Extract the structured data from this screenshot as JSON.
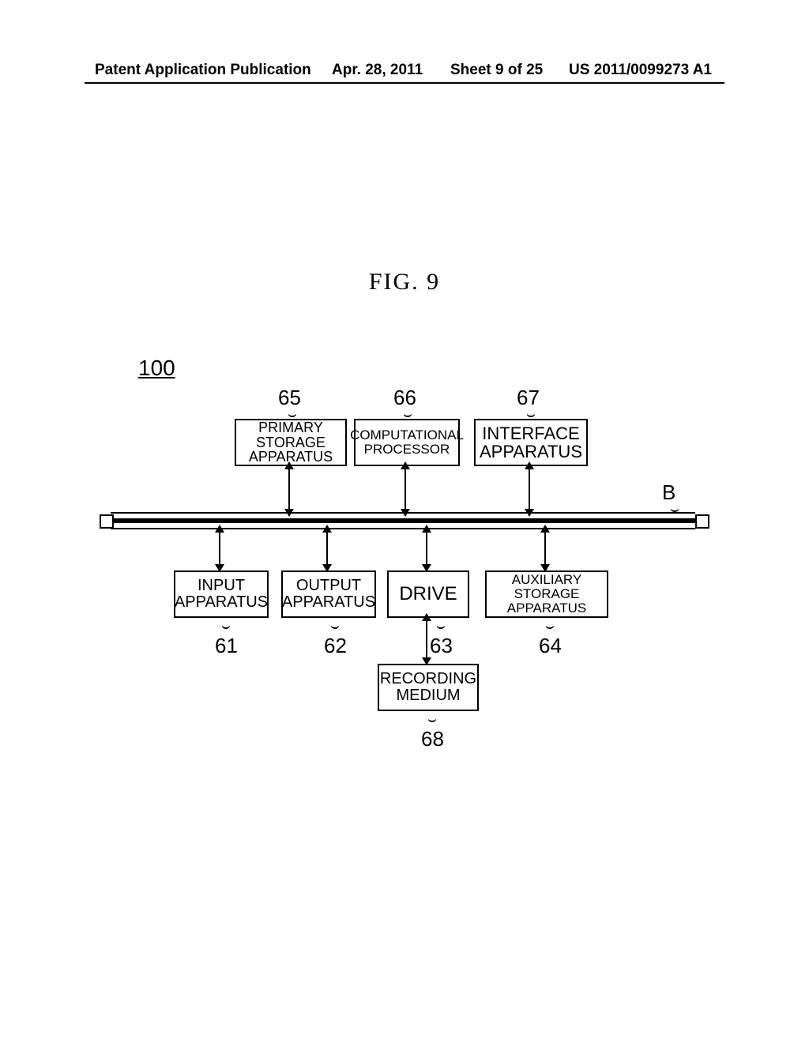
{
  "header": {
    "pub": "Patent Application Publication",
    "date": "Apr. 28, 2011",
    "sheet": "Sheet 9 of 25",
    "code": "US 2011/0099273 A1"
  },
  "figure_title": "FIG. 9",
  "ref100": "100",
  "bus_label": "B",
  "boxes": {
    "b65": {
      "l1": "PRIMARY STORAGE",
      "l2": "APPARATUS"
    },
    "b66": {
      "l1": "COMPUTATIONAL",
      "l2": "PROCESSOR"
    },
    "b67": {
      "l1": "INTERFACE",
      "l2": "APPARATUS"
    },
    "b61": {
      "l1": "INPUT",
      "l2": "APPARATUS"
    },
    "b62": {
      "l1": "OUTPUT",
      "l2": "APPARATUS"
    },
    "b63": {
      "l1": "DRIVE"
    },
    "b64": {
      "l1": "AUXILIARY STORAGE",
      "l2": "APPARATUS"
    },
    "b68": {
      "l1": "RECORDING",
      "l2": "MEDIUM"
    }
  },
  "refs": {
    "r65": "65",
    "r66": "66",
    "r67": "67",
    "r61": "61",
    "r62": "62",
    "r63": "63",
    "r64": "64",
    "r68": "68"
  },
  "chart_data": {
    "type": "diagram",
    "title": "FIG. 9",
    "group_ref": "100",
    "bus_ref": "B",
    "nodes": [
      {
        "id": "65",
        "label": "PRIMARY STORAGE APPARATUS"
      },
      {
        "id": "66",
        "label": "COMPUTATIONAL PROCESSOR"
      },
      {
        "id": "67",
        "label": "INTERFACE APPARATUS"
      },
      {
        "id": "61",
        "label": "INPUT APPARATUS"
      },
      {
        "id": "62",
        "label": "OUTPUT APPARATUS"
      },
      {
        "id": "63",
        "label": "DRIVE"
      },
      {
        "id": "64",
        "label": "AUXILIARY STORAGE APPARATUS"
      },
      {
        "id": "68",
        "label": "RECORDING MEDIUM"
      },
      {
        "id": "B",
        "label": "BUS"
      }
    ],
    "edges": [
      {
        "from": "65",
        "to": "B",
        "bidirectional": true
      },
      {
        "from": "66",
        "to": "B",
        "bidirectional": true
      },
      {
        "from": "67",
        "to": "B",
        "bidirectional": true
      },
      {
        "from": "61",
        "to": "B",
        "bidirectional": true
      },
      {
        "from": "62",
        "to": "B",
        "bidirectional": true
      },
      {
        "from": "63",
        "to": "B",
        "bidirectional": true
      },
      {
        "from": "64",
        "to": "B",
        "bidirectional": true
      },
      {
        "from": "63",
        "to": "68",
        "bidirectional": true
      }
    ]
  }
}
